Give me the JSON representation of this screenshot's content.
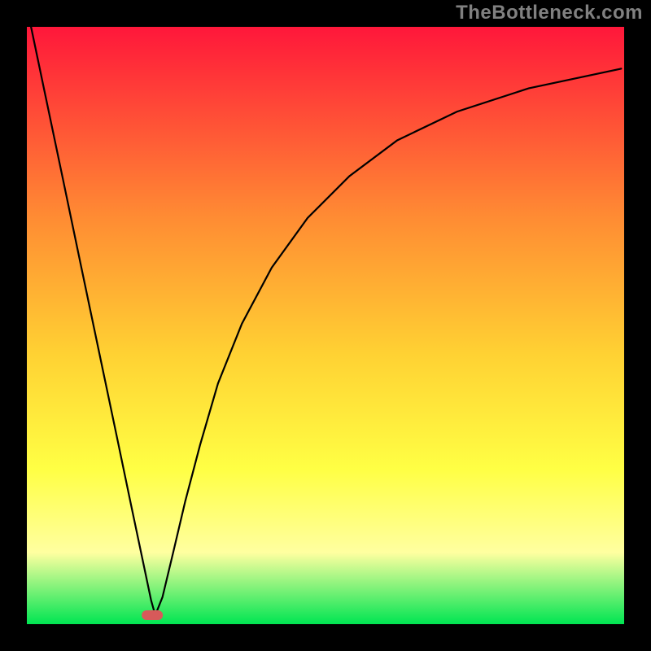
{
  "watermark": {
    "text": "TheBottleneck.com"
  },
  "chart_data": {
    "type": "line",
    "title": "",
    "xlabel": "",
    "ylabel": "",
    "xlim": [
      0,
      100
    ],
    "ylim": [
      0,
      100
    ],
    "grid": false,
    "legend": false,
    "background_gradient": {
      "top": "#ff173a",
      "mid1": "#ff8c33",
      "mid2": "#ffd233",
      "mid3": "#ffff44",
      "mid4": "#ffffa0",
      "bottom": "#00e552"
    },
    "marker": {
      "x": 21,
      "y": 1.5,
      "color": "#d75a5a",
      "shape": "pill"
    },
    "series": [
      {
        "name": "curve",
        "x": [
          0.7,
          3,
          6,
          9,
          12,
          15,
          17.5,
          19.5,
          20.8,
          21.5,
          22.7,
          24.5,
          26.5,
          29,
          32,
          36,
          41,
          47,
          54,
          62,
          72,
          84,
          99.5
        ],
        "y": [
          100,
          89,
          74.7,
          60.3,
          46,
          31.7,
          19.7,
          10.2,
          4,
          1.5,
          4.5,
          12,
          20.5,
          30,
          40.3,
          50.3,
          59.7,
          68,
          75,
          81,
          85.8,
          89.7,
          93
        ],
        "stroke": "#000000",
        "stroke_width": 2.2
      }
    ]
  }
}
